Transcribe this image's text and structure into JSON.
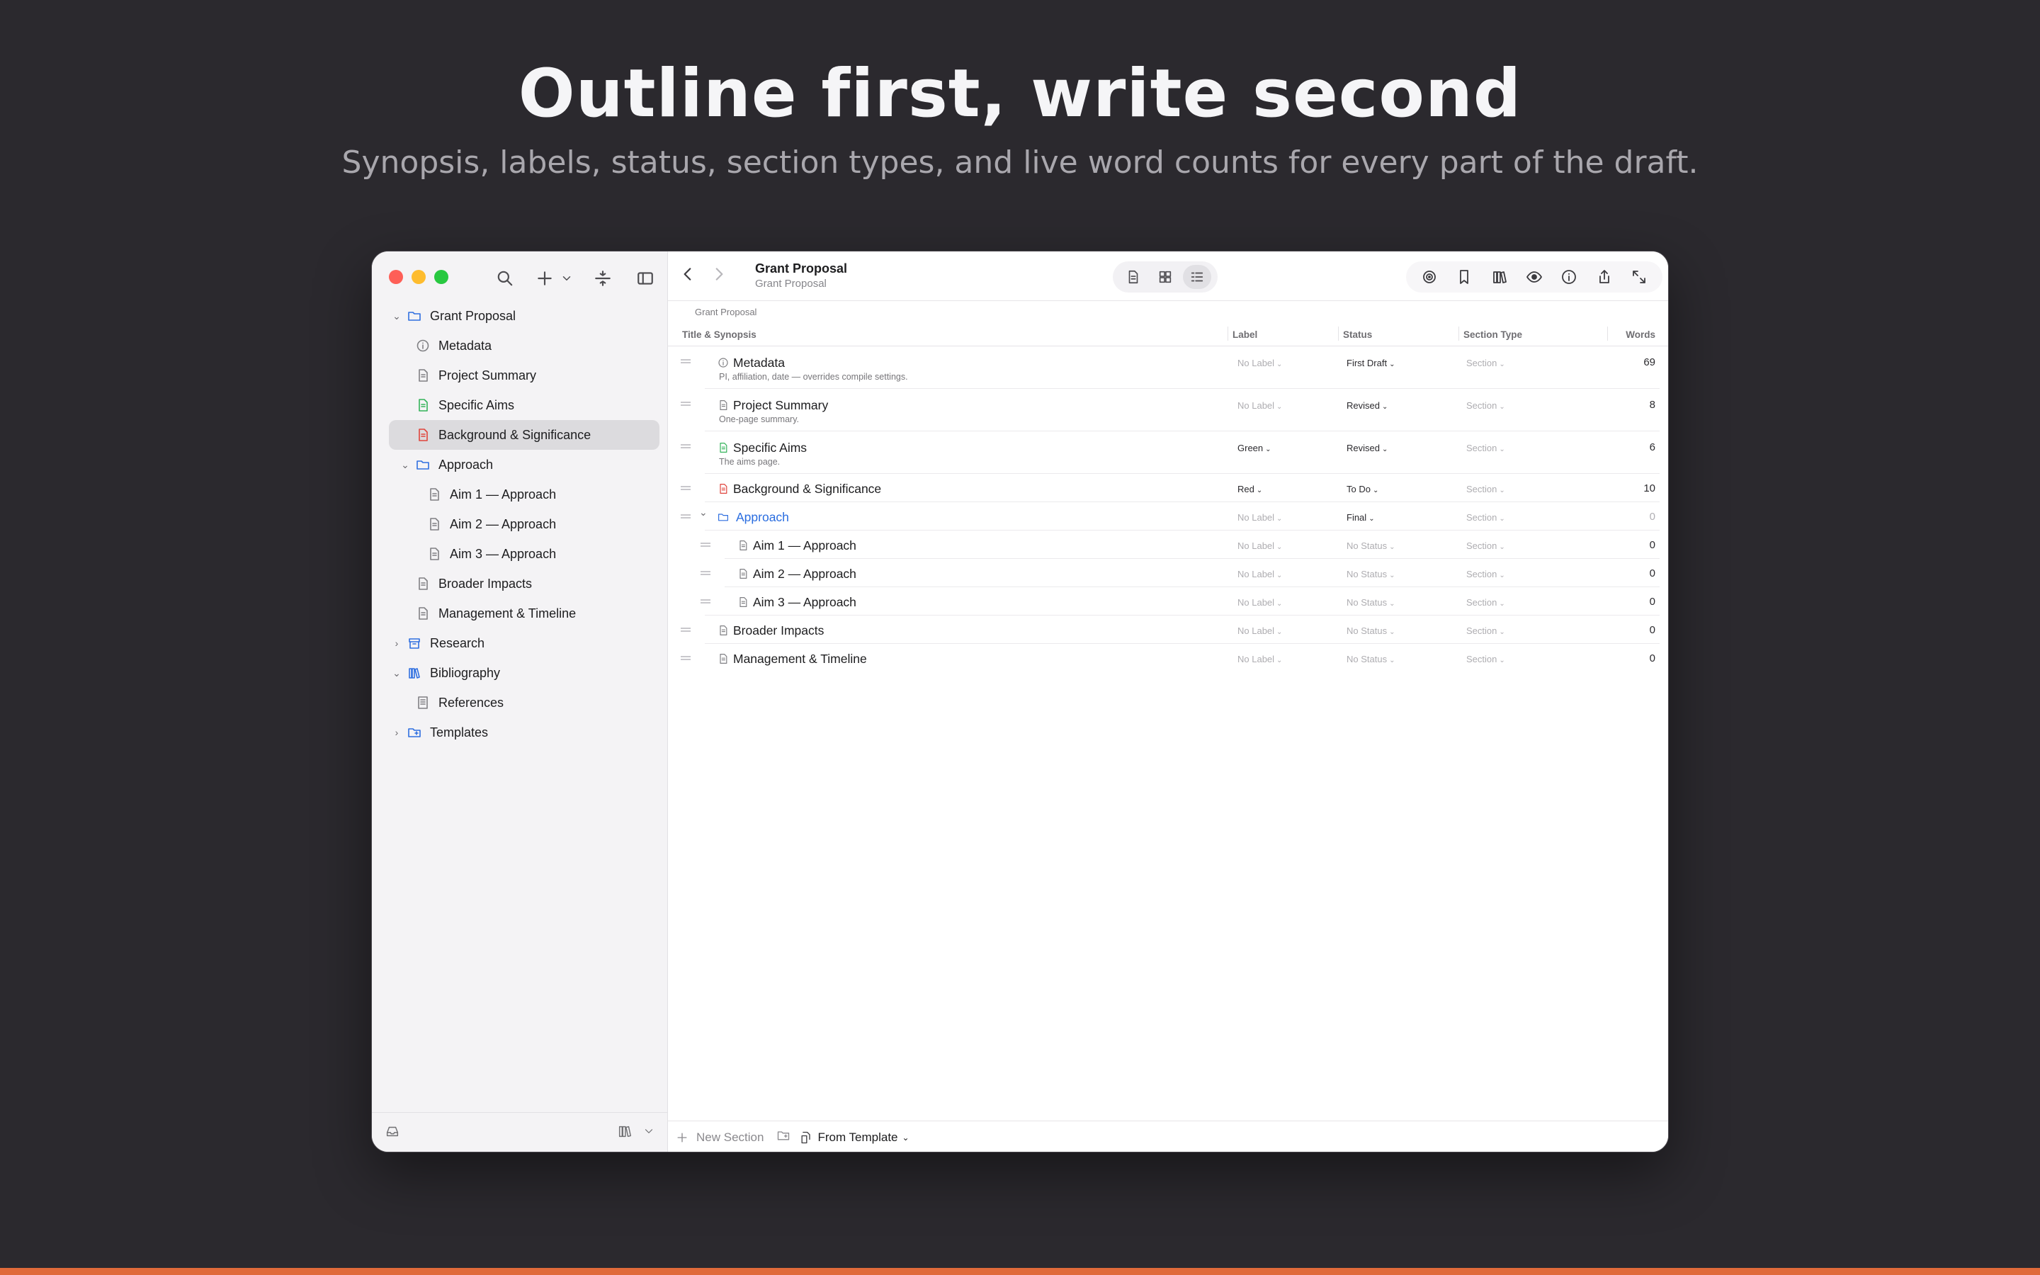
{
  "hero": {
    "title": "Outline first, write second",
    "subtitle": "Synopsis, labels, status, section types, and live word counts for every part of the draft."
  },
  "colors": {
    "accent_link": "#2a6de0",
    "folder": "#2f6fe0",
    "doc_default": "#808084",
    "doc_green": "#34b35a",
    "doc_red": "#e0443c",
    "selection": "#dcdbde",
    "footer_bar": "#e06a3a"
  },
  "binder": {
    "items": [
      {
        "label": "Grant Proposal",
        "icon": "folder-icon",
        "disclosure": "open"
      },
      {
        "label": "Metadata",
        "icon": "info-icon"
      },
      {
        "label": "Project Summary",
        "icon": "document-icon"
      },
      {
        "label": "Specific Aims",
        "icon": "document-green-icon"
      },
      {
        "label": "Background & Significance",
        "icon": "document-red-icon",
        "selected": true
      },
      {
        "label": "Approach",
        "icon": "folder-icon",
        "disclosure": "open"
      },
      {
        "label": "Aim 1 — Approach",
        "icon": "document-icon"
      },
      {
        "label": "Aim 2 — Approach",
        "icon": "document-icon"
      },
      {
        "label": "Aim 3 — Approach",
        "icon": "document-icon"
      },
      {
        "label": "Broader Impacts",
        "icon": "document-icon"
      },
      {
        "label": "Management & Timeline",
        "icon": "document-icon"
      },
      {
        "label": "Research",
        "icon": "archive-icon",
        "disclosure": "closed"
      },
      {
        "label": "Bibliography",
        "icon": "books-icon",
        "disclosure": "open"
      },
      {
        "label": "References",
        "icon": "references-icon"
      },
      {
        "label": "Templates",
        "icon": "template-folder-icon",
        "disclosure": "closed"
      }
    ]
  },
  "document": {
    "title": "Grant Proposal",
    "subtitle": "Grant Proposal",
    "breadcrumb": "Grant Proposal"
  },
  "outline": {
    "columns": {
      "title": "Title & Synopsis",
      "label": "Label",
      "status": "Status",
      "section_type": "Section Type",
      "words": "Words"
    },
    "rows": [
      {
        "title": "Metadata",
        "synopsis": "PI, affiliation, date — overrides compile settings.",
        "icon": "info-icon",
        "label": "No Label",
        "status": "First Draft",
        "section_type": "Section",
        "words": "69"
      },
      {
        "title": "Project Summary",
        "synopsis": "One-page summary.",
        "icon": "document-icon",
        "label": "No Label",
        "status": "Revised",
        "section_type": "Section",
        "words": "8"
      },
      {
        "title": "Specific Aims",
        "synopsis": "The aims page.",
        "icon": "document-green-icon",
        "label": "Green",
        "status": "Revised",
        "section_type": "Section",
        "words": "6"
      },
      {
        "title": "Background & Significance",
        "synopsis": "",
        "icon": "document-red-icon",
        "label": "Red",
        "status": "To Do",
        "section_type": "Section",
        "words": "10"
      },
      {
        "title": "Approach",
        "synopsis": "",
        "icon": "folder-icon",
        "label": "No Label",
        "status": "Final",
        "section_type": "Section",
        "words": "0"
      },
      {
        "title": "Aim 1 — Approach",
        "synopsis": "",
        "icon": "document-icon",
        "label": "No Label",
        "status": "No Status",
        "section_type": "Section",
        "words": "0"
      },
      {
        "title": "Aim 2 — Approach",
        "synopsis": "",
        "icon": "document-icon",
        "label": "No Label",
        "status": "No Status",
        "section_type": "Section",
        "words": "0"
      },
      {
        "title": "Aim 3 — Approach",
        "synopsis": "",
        "icon": "document-icon",
        "label": "No Label",
        "status": "No Status",
        "section_type": "Section",
        "words": "0"
      },
      {
        "title": "Broader Impacts",
        "synopsis": "",
        "icon": "document-icon",
        "label": "No Label",
        "status": "No Status",
        "section_type": "Section",
        "words": "0"
      },
      {
        "title": "Management & Timeline",
        "synopsis": "",
        "icon": "document-icon",
        "label": "No Label",
        "status": "No Status",
        "section_type": "Section",
        "words": "0"
      }
    ]
  },
  "footer": {
    "new_section": "New Section",
    "from_template": "From Template"
  }
}
